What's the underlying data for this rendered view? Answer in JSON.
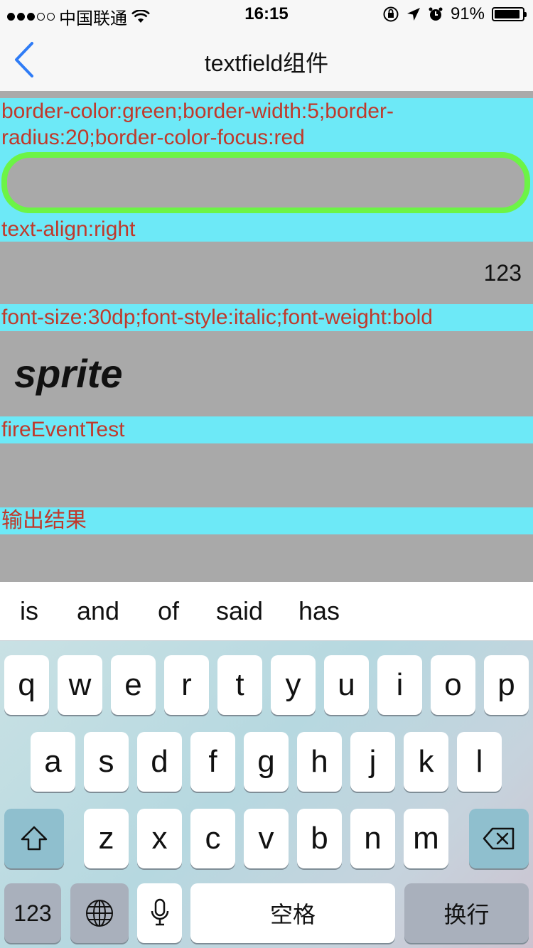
{
  "status_bar": {
    "carrier": "中国联通",
    "time": "16:15",
    "battery": "91%"
  },
  "nav": {
    "title": "textfield组件"
  },
  "sections": {
    "border_label": "border-color:green;border-width:5;border-radius:20;border-color-focus:red",
    "border_value": "",
    "align_label": "text-align:right",
    "align_value": "123",
    "font_label": "font-size:30dp;font-style:italic;font-weight:bold",
    "font_value": "sprite",
    "fire_label": "fireEventTest",
    "fire_value": "",
    "output_label": "输出结果",
    "output_value": ""
  },
  "suggestions": [
    "is",
    "and",
    "of",
    "said",
    "has"
  ],
  "keyboard": {
    "row1": [
      "q",
      "w",
      "e",
      "r",
      "t",
      "y",
      "u",
      "i",
      "o",
      "p"
    ],
    "row2": [
      "a",
      "s",
      "d",
      "f",
      "g",
      "h",
      "j",
      "k",
      "l"
    ],
    "row3": [
      "z",
      "x",
      "c",
      "v",
      "b",
      "n",
      "m"
    ],
    "numbers_key": "123",
    "space_key": "空格",
    "return_key": "换行"
  }
}
